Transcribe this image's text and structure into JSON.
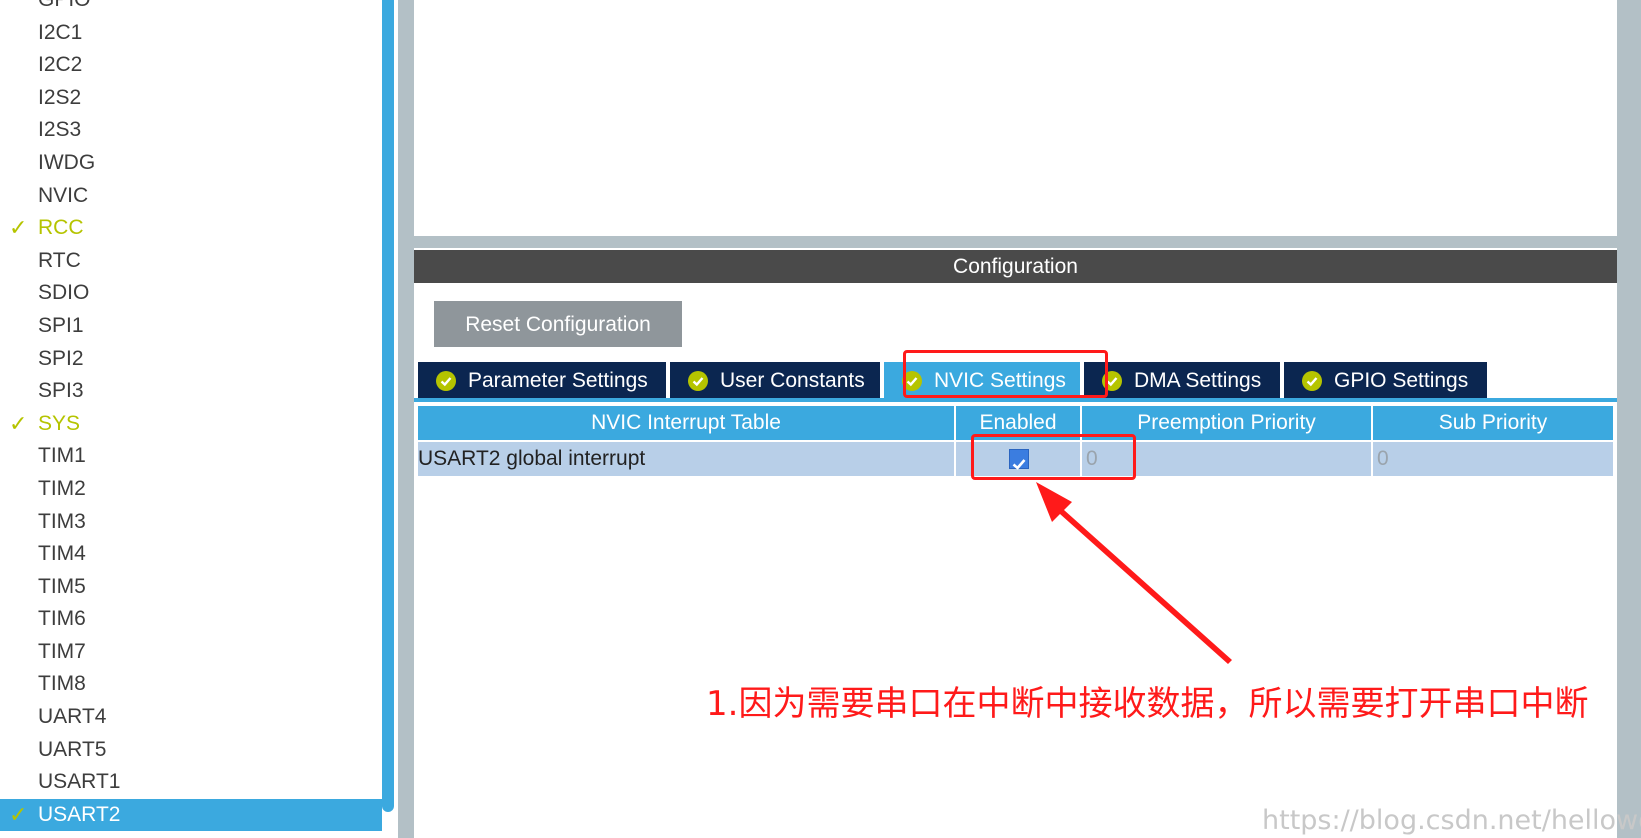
{
  "sidebar": {
    "items": [
      {
        "label": "GPIO",
        "state": "normal"
      },
      {
        "label": "I2C1",
        "state": "normal"
      },
      {
        "label": "I2C2",
        "state": "normal"
      },
      {
        "label": "I2S2",
        "state": "normal"
      },
      {
        "label": "I2S3",
        "state": "normal"
      },
      {
        "label": "IWDG",
        "state": "normal"
      },
      {
        "label": "NVIC",
        "state": "normal"
      },
      {
        "label": "RCC",
        "state": "configured"
      },
      {
        "label": "RTC",
        "state": "normal"
      },
      {
        "label": "SDIO",
        "state": "normal"
      },
      {
        "label": "SPI1",
        "state": "normal"
      },
      {
        "label": "SPI2",
        "state": "normal"
      },
      {
        "label": "SPI3",
        "state": "normal"
      },
      {
        "label": "SYS",
        "state": "configured"
      },
      {
        "label": "TIM1",
        "state": "normal"
      },
      {
        "label": "TIM2",
        "state": "normal"
      },
      {
        "label": "TIM3",
        "state": "normal"
      },
      {
        "label": "TIM4",
        "state": "normal"
      },
      {
        "label": "TIM5",
        "state": "normal"
      },
      {
        "label": "TIM6",
        "state": "normal"
      },
      {
        "label": "TIM7",
        "state": "normal"
      },
      {
        "label": "TIM8",
        "state": "normal"
      },
      {
        "label": "UART4",
        "state": "normal"
      },
      {
        "label": "UART5",
        "state": "normal"
      },
      {
        "label": "USART1",
        "state": "normal"
      },
      {
        "label": "USART2",
        "state": "selected"
      }
    ],
    "check_glyph": "✓"
  },
  "config": {
    "header": "Configuration",
    "reset_label": "Reset Configuration"
  },
  "tabs": [
    {
      "label": "Parameter Settings",
      "active": false,
      "icon": "check-circle-icon"
    },
    {
      "label": "User Constants",
      "active": false,
      "icon": "check-circle-icon"
    },
    {
      "label": "NVIC Settings",
      "active": true,
      "icon": "check-circle-icon"
    },
    {
      "label": "DMA Settings",
      "active": false,
      "icon": "check-circle-icon"
    },
    {
      "label": "GPIO Settings",
      "active": false,
      "icon": "check-circle-icon"
    }
  ],
  "nvic_table": {
    "columns": [
      "NVIC Interrupt Table",
      "Enabled",
      "Preemption Priority",
      "Sub Priority"
    ],
    "rows": [
      {
        "name": "USART2 global interrupt",
        "enabled": true,
        "preemption": "0",
        "sub": "0"
      }
    ]
  },
  "annotation": {
    "text": "1.因为需要串口在中断中接收数据，所以需要打开串口中断"
  },
  "watermark": "https://blog.csdn.net/helloworld",
  "colors": {
    "accent": "#3ba9df",
    "tab_dark": "#0b2650",
    "configured": "#b5c400",
    "annotation_red": "#ff1a1a"
  }
}
